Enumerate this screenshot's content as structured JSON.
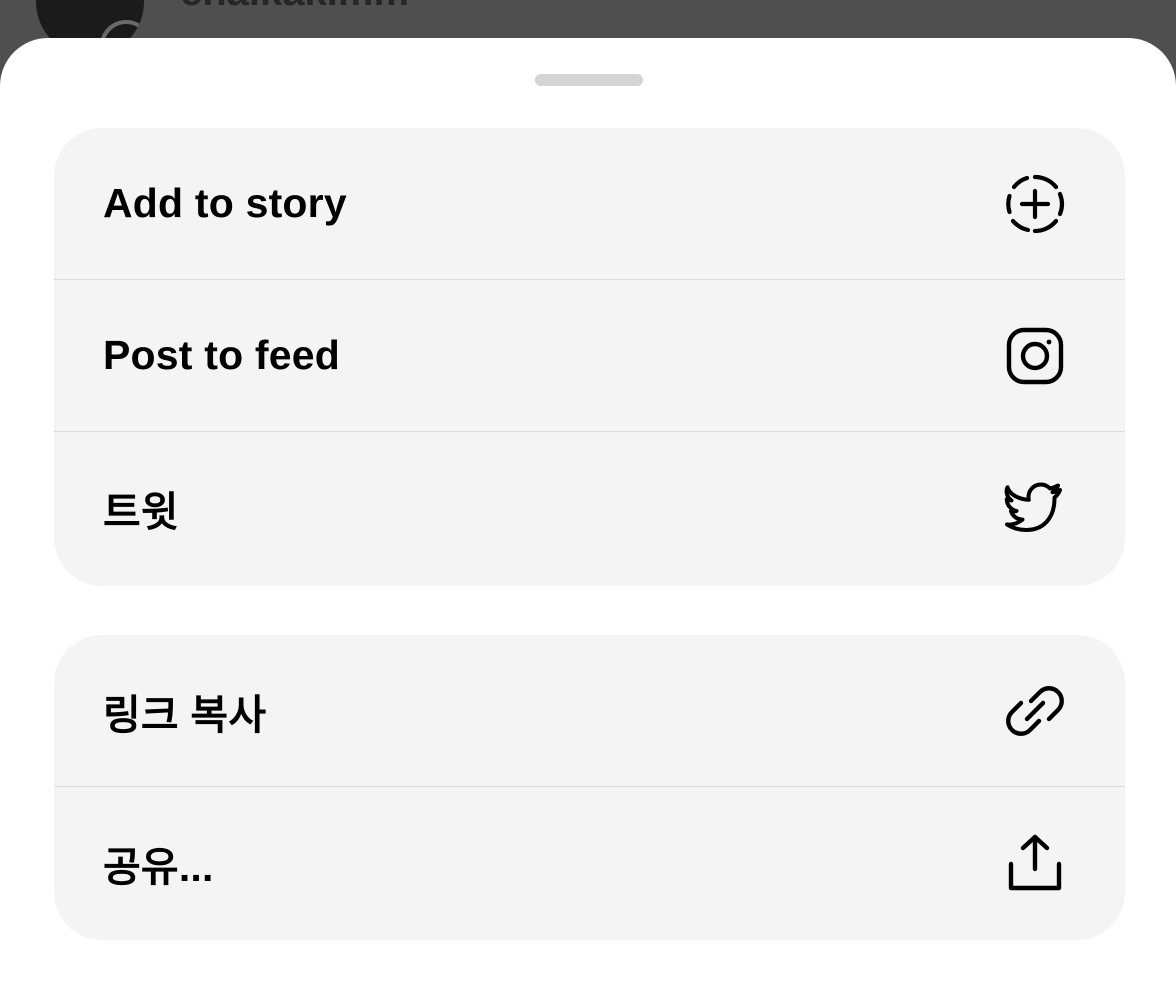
{
  "background": {
    "username": "chaikakimm",
    "subtext": "",
    "time": ""
  },
  "share_sheet": {
    "primary_actions": [
      {
        "label": "Add to story",
        "icon": "add-story-icon"
      },
      {
        "label": "Post to feed",
        "icon": "instagram-icon"
      },
      {
        "label": "트윗",
        "icon": "twitter-icon"
      }
    ],
    "secondary_actions": [
      {
        "label": "링크 복사",
        "icon": "link-icon"
      },
      {
        "label": "공유...",
        "icon": "share-icon"
      }
    ]
  },
  "colors": {
    "sheet_background": "#ffffff",
    "group_background": "#f4f4f4",
    "backdrop": "#4f4f4f",
    "text": "#000000",
    "divider": "#dcdcdc"
  }
}
